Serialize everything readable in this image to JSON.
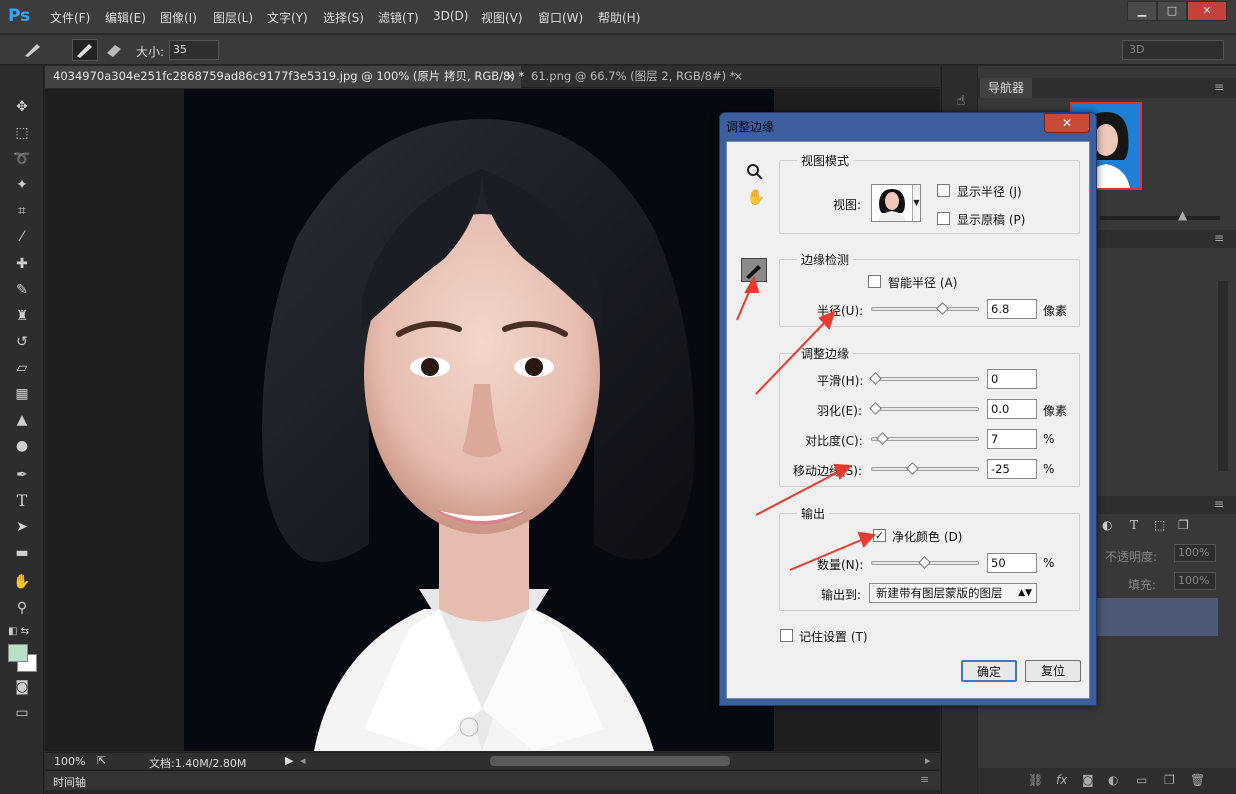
{
  "app": {
    "logo": "Ps"
  },
  "menu": [
    "文件(F)",
    "编辑(E)",
    "图像(I)",
    "图层(L)",
    "文字(Y)",
    "选择(S)",
    "滤镜(T)",
    "3D(D)",
    "视图(V)",
    "窗口(W)",
    "帮助(H)"
  ],
  "window_controls": [
    "▁",
    "□",
    "✕"
  ],
  "options": {
    "size_label": "大小:",
    "size_value": "35",
    "workspace": "3D"
  },
  "tabs": [
    {
      "label": "4034970a304e251fc2868759ad86c9177f3e5319.jpg @ 100% (原片 拷贝, RGB/8) *",
      "close": "×"
    },
    {
      "label": "61.png @ 66.7% (图层 2, RGB/8#) *",
      "close": "×"
    }
  ],
  "status": {
    "zoom": "100%",
    "doc": "文档:1.40M/2.80M"
  },
  "timeline": {
    "label": "时间轴"
  },
  "navigator": {
    "title": "导航器"
  },
  "layers_panel": {
    "opacity_label": "不透明度:",
    "opacity_value": "100%",
    "fill_label": "填充:",
    "fill_value": "100%",
    "layer_icons": [
      "T"
    ]
  },
  "dialog": {
    "title": "调整边缘",
    "close": "✕",
    "view_mode": {
      "title": "视图模式",
      "view_label": "视图:",
      "show_radius": {
        "label": "显示半径 (J)",
        "checked": false
      },
      "show_original": {
        "label": "显示原稿 (P)",
        "checked": false
      }
    },
    "edge_detection": {
      "title": "边缘检测",
      "smart_radius": {
        "label": "智能半径 (A)",
        "checked": false
      },
      "radius": {
        "label": "半径(U):",
        "value": "6.8",
        "unit": "像素",
        "fraction": 0.68
      }
    },
    "adjust_edge": {
      "title": "调整边缘",
      "smooth": {
        "label": "平滑(H):",
        "value": "0",
        "unit": "",
        "fraction": 0.0
      },
      "feather": {
        "label": "羽化(E):",
        "value": "0.0",
        "unit": "像素",
        "fraction": 0.0
      },
      "contrast": {
        "label": "对比度(C):",
        "value": "7",
        "unit": "%",
        "fraction": 0.07
      },
      "shift_edge": {
        "label": "移动边缘(S):",
        "value": "-25",
        "unit": "%",
        "fraction": 0.375
      }
    },
    "output": {
      "title": "输出",
      "decontaminate": {
        "label": "净化颜色 (D)",
        "checked": true
      },
      "amount": {
        "label": "数量(N):",
        "value": "50",
        "unit": "%",
        "fraction": 0.5
      },
      "output_to_label": "输出到:",
      "output_to_value": "新建带有图层蒙版的图层"
    },
    "remember": {
      "label": "记住设置 (T)",
      "checked": false
    },
    "ok": "确定",
    "reset": "复位"
  }
}
